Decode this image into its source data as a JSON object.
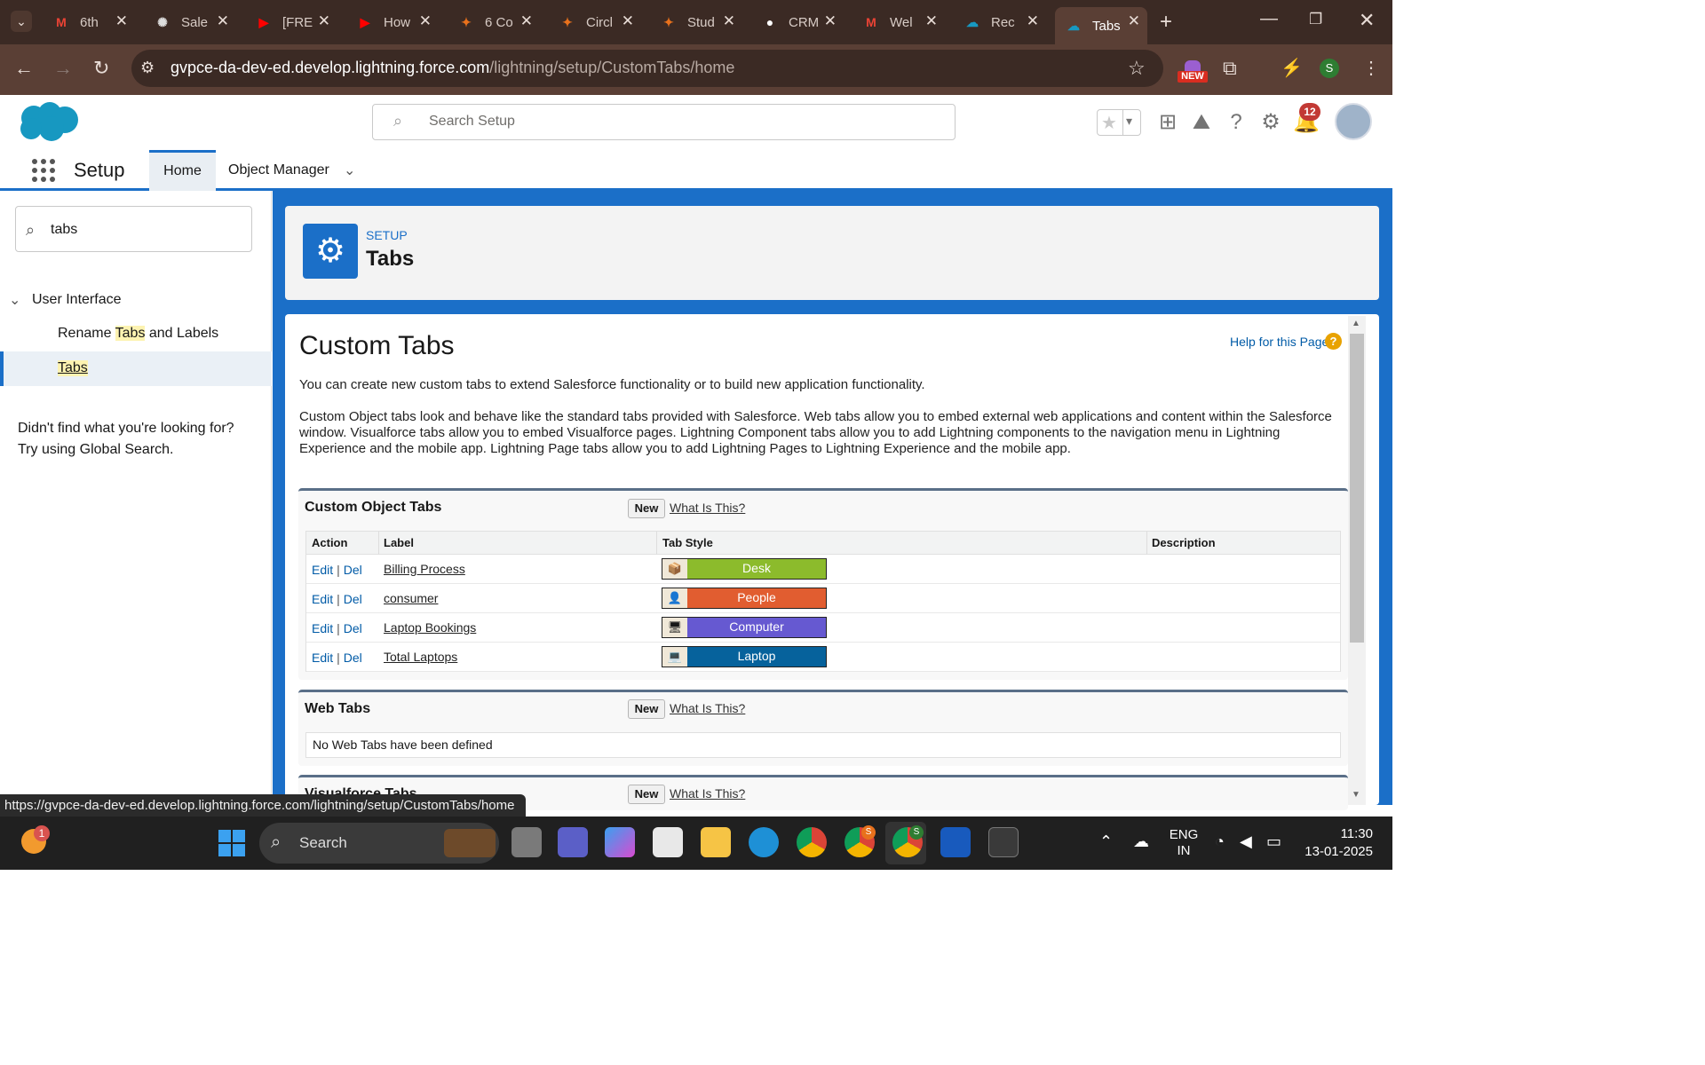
{
  "browser": {
    "tabs": [
      {
        "title": "6th",
        "icon": "gmail-icon"
      },
      {
        "title": "Sale",
        "icon": "openai-icon"
      },
      {
        "title": "[FRE",
        "icon": "youtube-icon"
      },
      {
        "title": "How",
        "icon": "youtube-icon"
      },
      {
        "title": "6 Co",
        "icon": "app-icon"
      },
      {
        "title": "Circl",
        "icon": "app-icon"
      },
      {
        "title": "Stud",
        "icon": "app-icon"
      },
      {
        "title": "CRM",
        "icon": "github-icon"
      },
      {
        "title": "Wel",
        "icon": "gmail-icon"
      },
      {
        "title": "Rec",
        "icon": "salesforce-icon"
      },
      {
        "title": "Tabs",
        "icon": "salesforce-icon"
      }
    ],
    "url_host": "gvpce-da-dev-ed.develop.lightning.force.com",
    "url_path": "/lightning/setup/CustomTabs/home",
    "new_badge": "NEW",
    "profile_initial": "S"
  },
  "sf": {
    "search_placeholder": "Search Setup",
    "notification_count": "12",
    "nav": {
      "app": "Setup",
      "home": "Home",
      "object_manager": "Object Manager"
    }
  },
  "left": {
    "quickfind": "tabs",
    "group": "User Interface",
    "items": [
      {
        "pre": "Rename ",
        "hl": "Tabs",
        "post": " and Labels"
      },
      {
        "hl": "Tabs"
      }
    ],
    "not_found_1": "Didn't find what you're looking for?",
    "not_found_2": "Try using Global Search."
  },
  "header": {
    "eyebrow": "SETUP",
    "title": "Tabs"
  },
  "content": {
    "title": "Custom Tabs",
    "help": "Help for this Page",
    "intro": "You can create new custom tabs to extend Salesforce functionality or to build new application functionality.",
    "para1": "Custom Object tabs look and behave like the standard tabs provided with Salesforce. Web tabs allow you to embed external web applications and content within the Salesforce",
    "para2": "window. Visualforce tabs allow you to embed Visualforce pages. Lightning Component tabs allow you to add Lightning components to the navigation menu in Lightning",
    "para3": "Experience and the mobile app. Lightning Page tabs allow you to add Lightning Pages to Lightning Experience and the mobile app.",
    "new_label": "New",
    "what_label": "What Is This?",
    "custom_object_tabs": {
      "title": "Custom Object Tabs",
      "columns": [
        "Action",
        "Label",
        "Tab Style",
        "Description"
      ],
      "edit": "Edit",
      "sep": "|",
      "del": "Del",
      "rows": [
        {
          "label": "Billing Process",
          "style": "Desk",
          "color": "#8cbb2c"
        },
        {
          "label": "consumer",
          "style": "People",
          "color": "#e15d30"
        },
        {
          "label": "Laptop Bookings",
          "style": "Computer",
          "color": "#6659d1"
        },
        {
          "label": "Total Laptops",
          "style": "Laptop",
          "color": "#06629c"
        }
      ]
    },
    "web_tabs": {
      "title": "Web Tabs",
      "empty": "No Web Tabs have been defined"
    },
    "visualforce_tabs": {
      "title": "Visualforce Tabs"
    }
  },
  "status_url": "https://gvpce-da-dev-ed.develop.lightning.force.com/lightning/setup/CustomTabs/home",
  "taskbar": {
    "search": "Search",
    "weather_badge": "1",
    "lang_1": "ENG",
    "lang_2": "IN",
    "time": "11:30",
    "date": "13-01-2025",
    "chrome_badge_1": "S",
    "chrome_badge_2": "S"
  },
  "colors": {
    "brand": "#1b6fc8",
    "link": "#015ba7",
    "chrome_dark": "#3b2a24",
    "chrome_mid": "#5a3f35"
  }
}
